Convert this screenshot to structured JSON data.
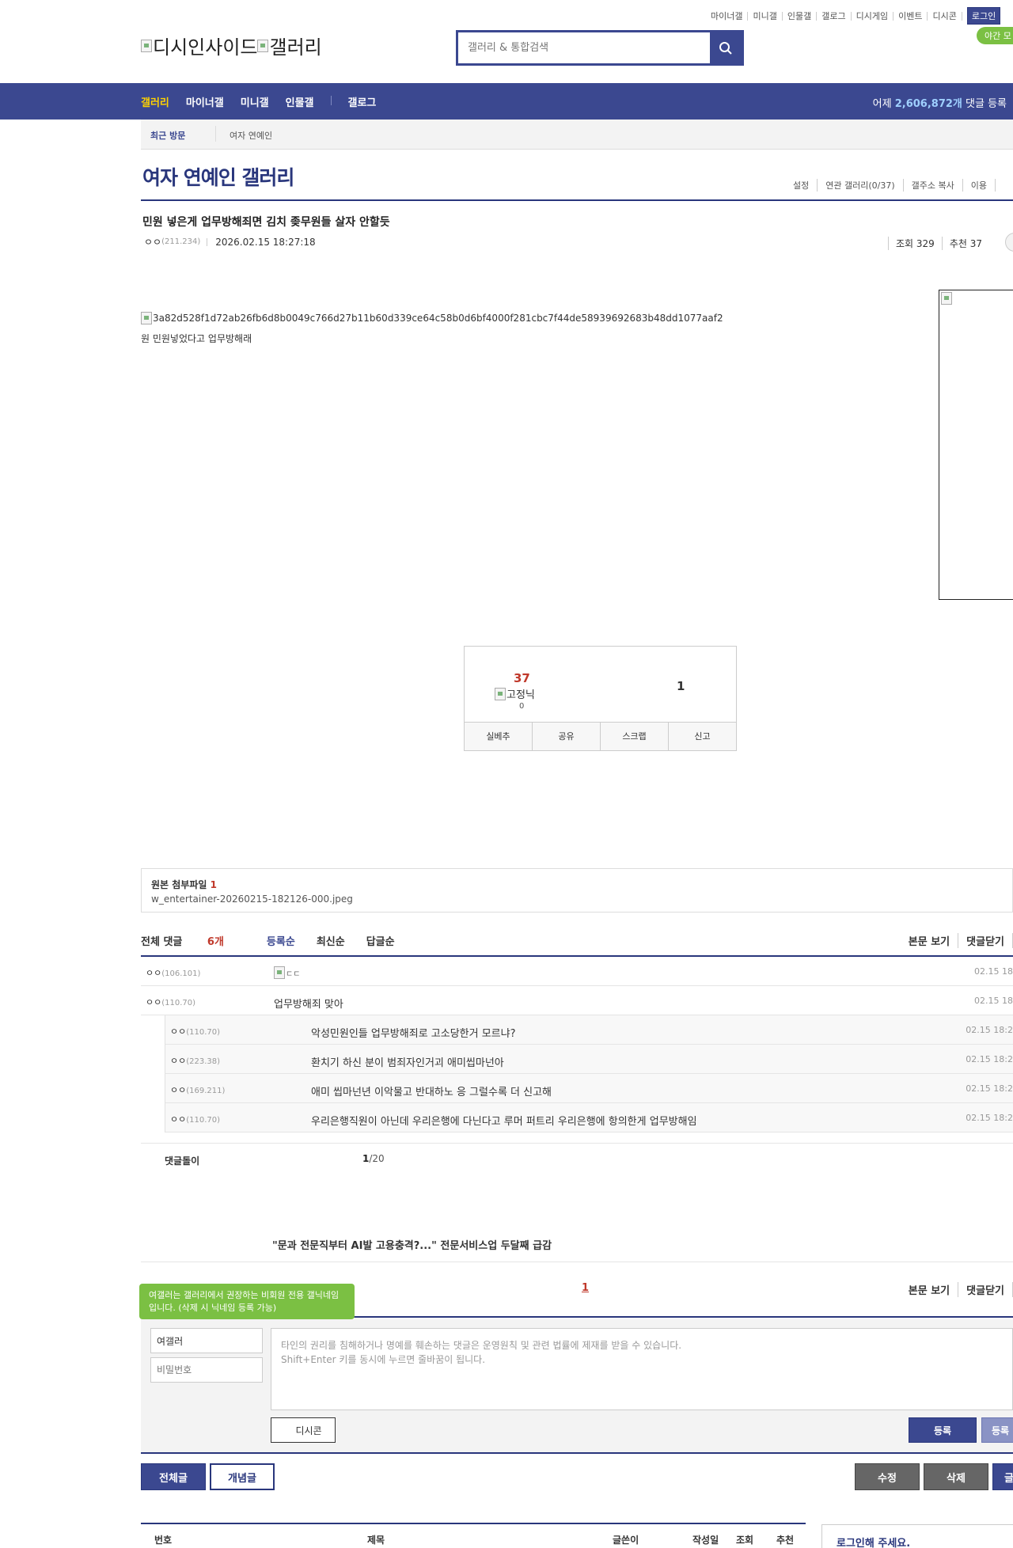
{
  "util_links": [
    "마이너갤",
    "미니갤",
    "인물갤",
    "갤로그",
    "디시게임",
    "이벤트",
    "디시콘"
  ],
  "login_label": "로그인",
  "night_label": "야간 모",
  "logo": {
    "part1": "디시인사이드",
    "part2": "갤러리"
  },
  "search": {
    "placeholder": "갤러리 & 통합검색"
  },
  "nav": {
    "items": [
      "갤러리",
      "마이너갤",
      "미니갤",
      "인물갤",
      "갤로그"
    ],
    "stat_prefix": "어제 ",
    "stat_count": "2,606,872개",
    "stat_suffix": " 댓글 등록"
  },
  "recent": {
    "label": "최근 방문",
    "gallery": "여자 연예인"
  },
  "gallery": {
    "title": "여자 연예인 갤러리",
    "menu": [
      "설정",
      "연관 갤러리(0/37)",
      "갤주소 복사",
      "이용"
    ]
  },
  "post": {
    "title": "민원 넣은게 업무방해죄면 김치 좆무원들 살자 안할듯",
    "author": "ㅇㅇ",
    "ip": "(211.234)",
    "date": "2026.02.15 18:27:18",
    "views": "조회 329",
    "recommend": "추천 37",
    "image_alt": "3a82d528f1d72ab26fb6d8b0049c766d27b11b60d339ce64c58b0d6bf4000f281cbc7f44de58939692683b48dd1077aaf2",
    "body": "원 민원넣었다고 업무방해래"
  },
  "recommend_box": {
    "up": "37",
    "fixed_nick": "고정닉",
    "fixed_count": "0",
    "down": "1",
    "buttons": [
      "실베추",
      "공유",
      "스크랩",
      "신고"
    ]
  },
  "attachment": {
    "label": "원본 첨부파일 ",
    "count": "1",
    "file": "w_entertainer-20260215-182126-000.jpeg"
  },
  "comments_header": {
    "total_label": "전체 댓글 ",
    "total_count": "6개",
    "sorts": [
      "등록순",
      "최신순",
      "답글순"
    ],
    "right": [
      "본문 보기",
      "댓글닫기"
    ]
  },
  "comments": [
    {
      "nick": "ㅇㅇ",
      "ip": "(106.101)",
      "text": "ㄷㄷ",
      "date": "02.15 18",
      "reply": false,
      "image": true
    },
    {
      "nick": "ㅇㅇ",
      "ip": "(110.70)",
      "text": "업무방해죄 맞아",
      "date": "02.15 18",
      "reply": false,
      "image": false
    },
    {
      "nick": "ㅇㅇ",
      "ip": "(110.70)",
      "text": "악성민원인들 업무방해죄로 고소당한거 모르냐?",
      "date": "02.15 18:2",
      "reply": true,
      "image": false
    },
    {
      "nick": "ㅇㅇ",
      "ip": "(223.38)",
      "text": "환치기 하신 분이 범죄자인거괴 애미씹마넌아",
      "date": "02.15 18:2",
      "reply": true,
      "image": false
    },
    {
      "nick": "ㅇㅇ",
      "ip": "(169.211)",
      "text": "애미 씹마넌년 이악물고 반대하노 응 그럴수록 더 신고해",
      "date": "02.15 18:2",
      "reply": true,
      "image": false
    },
    {
      "nick": "ㅇㅇ",
      "ip": "(110.70)",
      "text": "우리은행직원이 아닌데 우리은행에 다닌다고 루머 퍼트리 우리은행에 항의한게 업무방해임",
      "date": "02.15 18:2",
      "reply": true,
      "image": false
    }
  ],
  "comment_footer": {
    "label": "댓글돌이",
    "page_current": "1",
    "page_total": "/20"
  },
  "news": "\"문과 전문직부터 AI발 고용충격?...\" 전문서비스업 두달째 급감",
  "comments_header2": {
    "page": "1",
    "right": [
      "본문 보기",
      "댓글닫기"
    ]
  },
  "tip": "여갤러는 갤러리에서 권장하는 비회원 전용 갤닉네임입니다. (삭제 시 닉네임 등록 가능)",
  "write": {
    "nick_value": "여갤러",
    "pw_placeholder": "비밀번호",
    "textarea_line1": "타인의 권리를 침해하거나 명예를 훼손하는 댓글은 운영원칙 및 관련 법률에 제재를 받을 수 있습니다.",
    "textarea_line2": "Shift+Enter 키를 동시에 누르면 줄바꿈이 됩니다.",
    "dccon": "디시콘",
    "submit": "등록",
    "submit2": "등록"
  },
  "bottom_buttons": {
    "all": "전체글",
    "concept": "개념글",
    "edit": "수정",
    "delete": "삭제",
    "write": "글"
  },
  "table_head": [
    "번호",
    "제목",
    "글쓴이",
    "작성일",
    "조회",
    "추천"
  ],
  "login_prompt": "로그인해 주세요."
}
